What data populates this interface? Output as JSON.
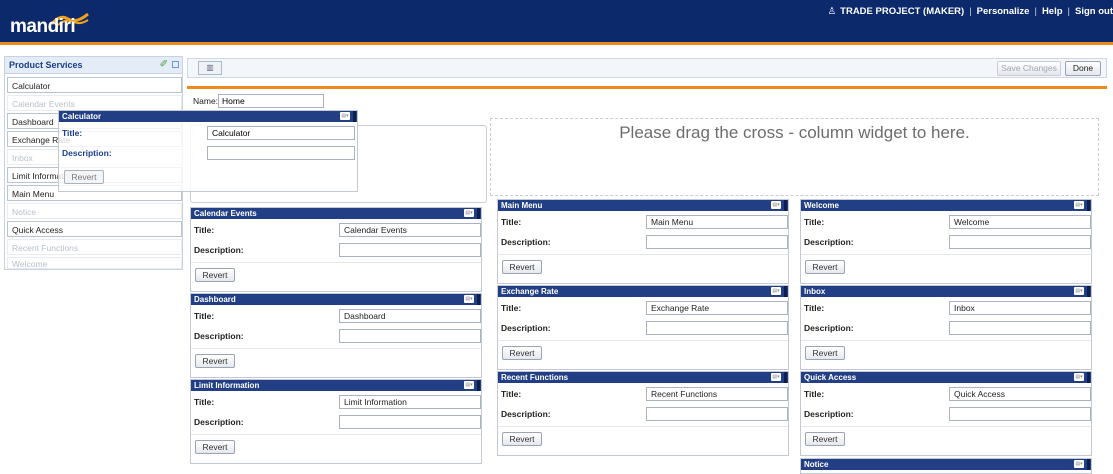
{
  "header": {
    "logo": "mandiri",
    "user": "TRADE PROJECT (MAKER)",
    "links": [
      "Personalize",
      "Help",
      "Sign out"
    ]
  },
  "sidebar": {
    "title": "Product Services",
    "items": [
      {
        "label": "Calculator",
        "enabled": true
      },
      {
        "label": "Calendar Events",
        "enabled": false
      },
      {
        "label": "Dashboard",
        "enabled": true
      },
      {
        "label": "Exchange Rate",
        "enabled": true
      },
      {
        "label": "Inbox",
        "enabled": false
      },
      {
        "label": "Limit Information",
        "enabled": true
      },
      {
        "label": "Main Menu",
        "enabled": true
      },
      {
        "label": "Notice",
        "enabled": false
      },
      {
        "label": "Quick Access",
        "enabled": true
      },
      {
        "label": "Recent Functions",
        "enabled": false
      },
      {
        "label": "Welcome",
        "enabled": false
      }
    ]
  },
  "toolbar": {
    "save_label": "Save Changes",
    "done_label": "Done"
  },
  "page": {
    "name_label": "Name:",
    "name_value": "Home",
    "drop_hint": "Please drag the cross - column widget to here."
  },
  "labels": {
    "title": "Title:",
    "description": "Description:",
    "revert": "Revert"
  },
  "dragging_widget": {
    "header": "Calculator",
    "title_value": "Calculator",
    "description_value": ""
  },
  "widgets": {
    "calendar_events": {
      "header": "Calendar Events",
      "title_value": "Calendar Events",
      "description_value": ""
    },
    "dashboard": {
      "header": "Dashboard",
      "title_value": "Dashboard",
      "description_value": ""
    },
    "limit_information": {
      "header": "Limit Information",
      "title_value": "Limit Information",
      "description_value": ""
    },
    "main_menu": {
      "header": "Main Menu",
      "title_value": "Main Menu",
      "description_value": ""
    },
    "exchange_rate": {
      "header": "Exchange Rate",
      "title_value": "Exchange Rate",
      "description_value": ""
    },
    "recent_functions": {
      "header": "Recent Functions",
      "title_value": "Recent Functions",
      "description_value": ""
    },
    "welcome": {
      "header": "Welcome",
      "title_value": "Welcome",
      "description_value": ""
    },
    "inbox": {
      "header": "Inbox",
      "title_value": "Inbox",
      "description_value": ""
    },
    "quick_access": {
      "header": "Quick Access",
      "title_value": "Quick Access",
      "description_value": ""
    },
    "notice": {
      "header": "Notice"
    }
  },
  "colors": {
    "header_bg": "#0c2a6b",
    "accent_orange": "#ec8a1c",
    "widget_header": "#223f86"
  }
}
